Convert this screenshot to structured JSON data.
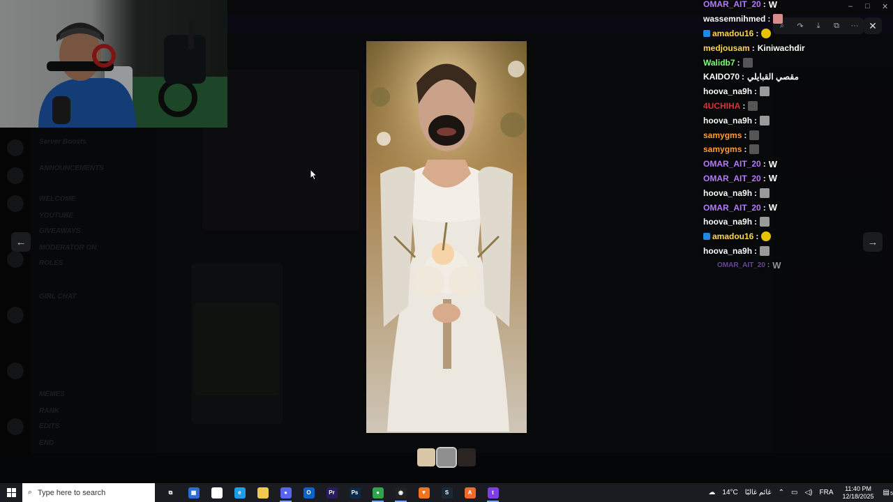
{
  "chat": {
    "messages": [
      {
        "user": "OMAR_AIT_20",
        "color": "#b57cff",
        "text": "",
        "emote": "W"
      },
      {
        "user": "wassemnihmed",
        "color": "#ffffff",
        "text": "",
        "emote": "img-pink"
      },
      {
        "user": "amadou16",
        "color": "#ffd84d",
        "text": "",
        "emote": "img-yellow",
        "badge": true
      },
      {
        "user": "medjousam",
        "color": "#ffd84d",
        "text": "Kiniwachdir",
        "emote": ""
      },
      {
        "user": "Walidb7",
        "color": "#7cff7c",
        "text": "",
        "emote": "img-bw"
      },
      {
        "user": "KAIDO70",
        "color": "#ffffff",
        "text": "مقصي القبايلي",
        "emote": ""
      },
      {
        "user": "hoova_na9h",
        "color": "#ffffff",
        "text": "",
        "emote": "img-gray"
      },
      {
        "user": "4UCHIHA",
        "color": "#e0303a",
        "text": "",
        "emote": "img-bw"
      },
      {
        "user": "hoova_na9h",
        "color": "#ffffff",
        "text": "",
        "emote": "img-gray"
      },
      {
        "user": "samygms",
        "color": "#ff9f3a",
        "text": "",
        "emote": "img-bw"
      },
      {
        "user": "samygms",
        "color": "#ff9f3a",
        "text": "",
        "emote": "img-bw"
      },
      {
        "user": "OMAR_AIT_20",
        "color": "#b57cff",
        "text": "",
        "emote": "W"
      },
      {
        "user": "OMAR_AIT_20",
        "color": "#b57cff",
        "text": "",
        "emote": "W"
      },
      {
        "user": "hoova_na9h",
        "color": "#ffffff",
        "text": "",
        "emote": "img-gray"
      },
      {
        "user": "OMAR_AIT_20",
        "color": "#b57cff",
        "text": "",
        "emote": "W"
      },
      {
        "user": "hoova_na9h",
        "color": "#ffffff",
        "text": "",
        "emote": "img-gray"
      },
      {
        "user": "amadou16",
        "color": "#ffd84d",
        "text": "",
        "emote": "img-yellow",
        "badge": true
      },
      {
        "user": "hoova_na9h",
        "color": "#ffffff",
        "text": "",
        "emote": "img-gray"
      },
      {
        "user": "OMAR_AIT_20",
        "color": "#b57cff",
        "text": "",
        "emote": "W",
        "faded": true
      }
    ]
  },
  "lightbox": {
    "icons": [
      "zoom-icon",
      "forward-icon",
      "download-icon",
      "open-external-icon",
      "more-icon"
    ],
    "close_icon": "close-icon",
    "prev_icon": "arrow-left-icon",
    "next_icon": "arrow-right-icon"
  },
  "channels": [
    {
      "name": "Server Boosts"
    },
    {
      "name": "ANNOUNCEMENTS"
    },
    {
      "name": "WELCOME"
    },
    {
      "name": "YOUTUBE"
    },
    {
      "name": "GIVEAWAYS"
    },
    {
      "name": "MODERATOR ON"
    },
    {
      "name": "ROLES"
    },
    {
      "name": "GIRL CHAT"
    },
    {
      "name": "MEMES"
    },
    {
      "name": "RANK"
    },
    {
      "name": "EDITS"
    },
    {
      "name": "END"
    }
  ],
  "taskbar": {
    "search_placeholder": "Type here to search",
    "weather_temp": "14°C",
    "weather_text": "غائم غالبًا",
    "language": "FRA",
    "time": "11:40 PM",
    "date": "12/18/2025",
    "notification_count": "5",
    "apps": [
      {
        "name": "task-view-icon",
        "color": "#1a1c22",
        "label": "⧉"
      },
      {
        "name": "microsoft-store-icon",
        "color": "#2b6cd8",
        "label": "▦"
      },
      {
        "name": "file-icon",
        "color": "#ffffff",
        "label": ""
      },
      {
        "name": "edge-icon",
        "color": "#1e9ee6",
        "label": "e"
      },
      {
        "name": "file-explorer-icon",
        "color": "#f2c94c",
        "label": ""
      },
      {
        "name": "discord-icon",
        "color": "#5865f2",
        "label": "●",
        "active": true
      },
      {
        "name": "outlook-icon",
        "color": "#0a64c8",
        "label": "O"
      },
      {
        "name": "premiere-icon",
        "color": "#2a1a5e",
        "label": "Pr"
      },
      {
        "name": "photoshop-icon",
        "color": "#0b2a4a",
        "label": "Ps"
      },
      {
        "name": "chrome-icon",
        "color": "#2ea44f",
        "label": "●",
        "active": true
      },
      {
        "name": "obs-icon",
        "color": "#222222",
        "label": "◉",
        "active": true
      },
      {
        "name": "brave-icon",
        "color": "#f2731d",
        "label": "▼"
      },
      {
        "name": "steam-icon",
        "color": "#1b2838",
        "label": "S"
      },
      {
        "name": "app-orange-icon",
        "color": "#f06a2a",
        "label": "A"
      },
      {
        "name": "twitch-icon",
        "color": "#7b3fe4",
        "label": "t",
        "active": true
      }
    ]
  }
}
